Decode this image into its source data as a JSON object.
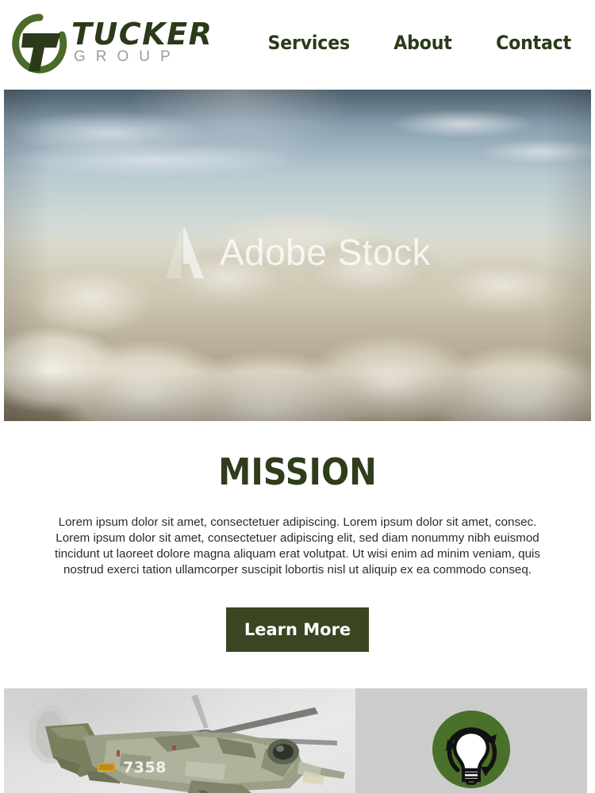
{
  "header": {
    "logo": {
      "mark_icon": "tucker-t-circle-logo",
      "primary": "TUCKER",
      "secondary": "GROUP",
      "mark_color": "#4a6b2a",
      "t_color": "#2b3a18",
      "secondary_color": "#9a9d96"
    },
    "nav": [
      {
        "label": "Services",
        "name": "nav-link-services"
      },
      {
        "label": "About",
        "name": "nav-link-about"
      },
      {
        "label": "Contact",
        "name": "nav-link-contact"
      }
    ]
  },
  "hero": {
    "alt": "aerial view above a sea of clouds",
    "watermark": {
      "mark_icon": "adobe-stock-a-mark",
      "text": "Adobe Stock"
    }
  },
  "mission": {
    "title": "MISSION",
    "title_color": "#2f3d1b",
    "body": "Lorem ipsum dolor sit amet, consectetuer adipiscing. Lorem ipsum dolor sit amet, consec. Lorem ipsum dolor sit amet, consectetuer adipiscing elit, sed diam nonummy nibh euismod tincidunt ut laoreet dolore magna aliquam erat volutpat. Ut wisi enim ad minim veniam, quis nostrud exerci tation ullamcorper suscipit lobortis nisl ut aliquip ex ea commodo conseq.",
    "cta": {
      "label": "Learn More",
      "bg_color": "#3b4522",
      "text_color": "#ffffff"
    }
  },
  "bottom": {
    "photo": {
      "alt": "military helicopter in flight",
      "tail_number": "7358"
    },
    "panel": {
      "bg_color": "#cccccc",
      "icon": {
        "name": "lightbulb-recycle-icon",
        "circle_color": "#4a7029",
        "bulb_color": "#ffffff",
        "arrow_color": "#111111"
      }
    }
  }
}
